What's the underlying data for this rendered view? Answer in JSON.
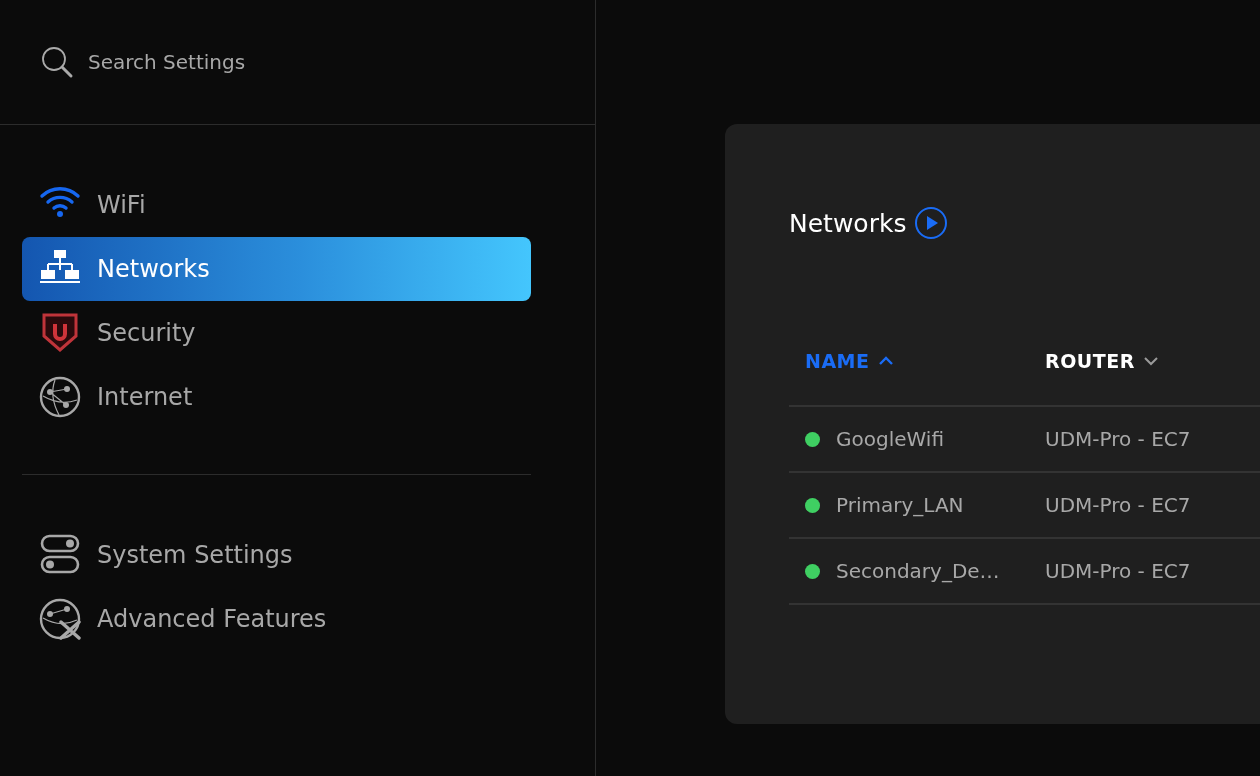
{
  "search": {
    "placeholder": "Search Settings"
  },
  "sidebar": {
    "groups": [
      {
        "items": [
          {
            "label": "WiFi",
            "selected": false
          },
          {
            "label": "Networks",
            "selected": true
          },
          {
            "label": "Security",
            "selected": false
          },
          {
            "label": "Internet",
            "selected": false
          }
        ]
      },
      {
        "items": [
          {
            "label": "System Settings",
            "selected": false
          },
          {
            "label": "Advanced Features",
            "selected": false
          }
        ]
      }
    ]
  },
  "panel": {
    "title": "Networks",
    "table": {
      "columns": [
        {
          "label": "NAME",
          "sorted": true
        },
        {
          "label": "ROUTER",
          "sorted": false
        }
      ],
      "rows": [
        {
          "name": "GoogleWifi",
          "router": "UDM-Pro - EC7",
          "color": "#3fcf62"
        },
        {
          "name": "Primary_LAN",
          "router": "UDM-Pro - EC7",
          "color": "#3fcf62"
        },
        {
          "name": "Secondary_De…",
          "router": "UDM-Pro - EC7",
          "color": "#3fcf62"
        }
      ]
    }
  }
}
